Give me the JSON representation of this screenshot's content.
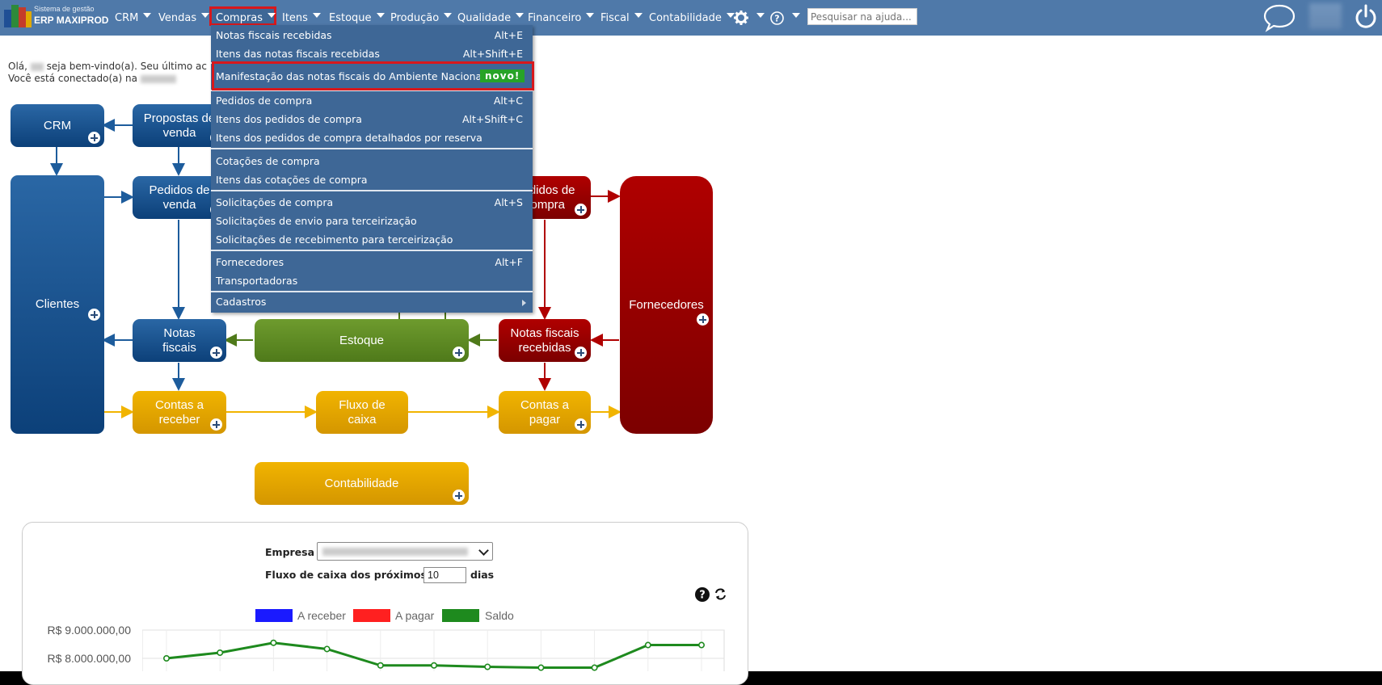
{
  "brand": {
    "line1": "Sistema de gestão",
    "line2": "ERP MAXIPROD"
  },
  "nav": [
    {
      "label": "CRM"
    },
    {
      "label": "Vendas"
    },
    {
      "label": "Compras"
    },
    {
      "label": "Itens"
    },
    {
      "label": "Estoque"
    },
    {
      "label": "Produção"
    },
    {
      "label": "Qualidade"
    },
    {
      "label": "Financeiro"
    },
    {
      "label": "Fiscal"
    },
    {
      "label": "Contabilidade"
    }
  ],
  "search": {
    "placeholder": "Pesquisar na ajuda..."
  },
  "welcome": {
    "line1_a": "Olá,",
    "line1_b": "seja bem-vindo(a). Seu último ac",
    "line2": "Você está conectado(a) na"
  },
  "menu": {
    "items": [
      {
        "label": "Notas fiscais recebidas",
        "shortcut": "Alt+E"
      },
      {
        "label": "Itens das notas fiscais recebidas",
        "shortcut": "Alt+Shift+E"
      },
      {
        "label": "Manifestação das notas fiscais do Ambiente Nacional",
        "badge": "novo!"
      },
      {
        "label": "Pedidos de compra",
        "shortcut": "Alt+C"
      },
      {
        "label": "Itens dos pedidos de compra",
        "shortcut": "Alt+Shift+C"
      },
      {
        "label": "Itens dos pedidos de compra detalhados por reserva"
      },
      {
        "label": "Cotações de compra"
      },
      {
        "label": "Itens das cotações de compra"
      },
      {
        "label": "Solicitações de compra",
        "shortcut": "Alt+S"
      },
      {
        "label": "Solicitações de envio para terceirização"
      },
      {
        "label": "Solicitações de recebimento para terceirização"
      },
      {
        "label": "Fornecedores",
        "shortcut": "Alt+F"
      },
      {
        "label": "Transportadoras"
      },
      {
        "label": "Cadastros"
      }
    ]
  },
  "flow": {
    "crm": "CRM",
    "propostas": "Propostas de venda",
    "clientes": "Clientes",
    "pedidos_venda": "Pedidos de venda",
    "pedidos_compra": "Pedidos de compra",
    "fornecedores": "Fornecedores",
    "notas_fiscais": "Notas fiscais",
    "estoque": "Estoque",
    "notas_recebidas": "Notas fiscais recebidas",
    "contas_receber": "Contas a receber",
    "fluxo_caixa": "Fluxo de caixa",
    "contas_pagar": "Contas a pagar",
    "contabilidade": "Contabilidade"
  },
  "panel": {
    "empresa_label": "Empresa",
    "fluxo_label": "Fluxo de caixa dos próximos",
    "days_value": "10",
    "days_unit": "dias"
  },
  "chart_data": {
    "type": "line",
    "series": [
      {
        "name": "A receber",
        "color": "#1a1aff",
        "values": []
      },
      {
        "name": "A pagar",
        "color": "#ff2020",
        "values": []
      },
      {
        "name": "Saldo",
        "color": "#1e8a1e",
        "values": [
          8000000,
          8200000,
          8550000,
          8330000,
          7750000,
          7750000,
          7700000,
          7670000,
          7670000,
          8470000,
          8470000
        ]
      }
    ],
    "yticks": [
      "R$ 9.000.000,00",
      "R$ 8.000.000,00"
    ],
    "legend": "top"
  }
}
